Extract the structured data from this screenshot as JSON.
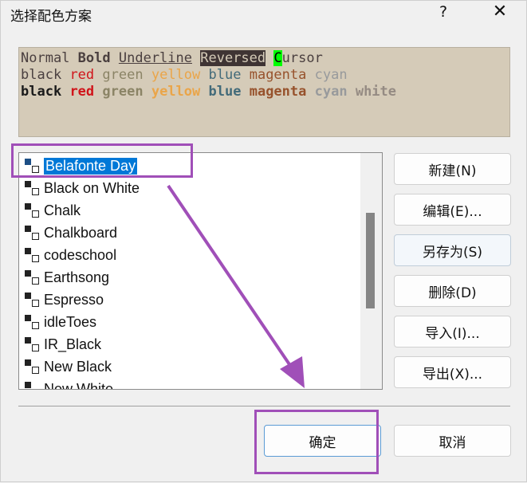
{
  "window": {
    "title": "选择配色方案",
    "help": "?",
    "close": "✕"
  },
  "preview": {
    "line1": {
      "normal": "Normal",
      "bold": "Bold",
      "underline": "Underline",
      "reversed": "Reversed",
      "cursor_char": "C",
      "cursor_rest": "ursor"
    },
    "normal_colors": [
      {
        "t": "black",
        "c": "#4a4040"
      },
      {
        "t": "red",
        "c": "#d0141a"
      },
      {
        "t": "green",
        "c": "#8b8466"
      },
      {
        "t": "yellow",
        "c": "#eaa549"
      },
      {
        "t": "blue",
        "c": "#426a79"
      },
      {
        "t": "magenta",
        "c": "#97522c"
      },
      {
        "t": "cyan",
        "c": "#989a9c"
      }
    ],
    "bold_colors": [
      {
        "t": "black",
        "c": "#1a1a1a"
      },
      {
        "t": "red",
        "c": "#d0141a"
      },
      {
        "t": "green",
        "c": "#8b8466"
      },
      {
        "t": "yellow",
        "c": "#eaa549"
      },
      {
        "t": "blue",
        "c": "#426a79"
      },
      {
        "t": "magenta",
        "c": "#97522c"
      },
      {
        "t": "cyan",
        "c": "#989a9c"
      },
      {
        "t": "white",
        "c": "#958b83"
      }
    ],
    "background": "#d5cbb8"
  },
  "schemes": [
    "Belafonte Day",
    "Black on White",
    "Chalk",
    "Chalkboard",
    "codeschool",
    "Earthsong",
    "Espresso",
    "idleToes",
    "IR_Black",
    "New Black",
    "New White"
  ],
  "selected_scheme": "Belafonte Day",
  "buttons": {
    "new": "新建(N)",
    "edit": "编辑(E)...",
    "save_as": "另存为(S)",
    "delete": "删除(D)",
    "import": "导入(I)...",
    "export": "导出(X)...",
    "ok": "确定",
    "cancel": "取消"
  },
  "annotation_color": "#a04fb8"
}
